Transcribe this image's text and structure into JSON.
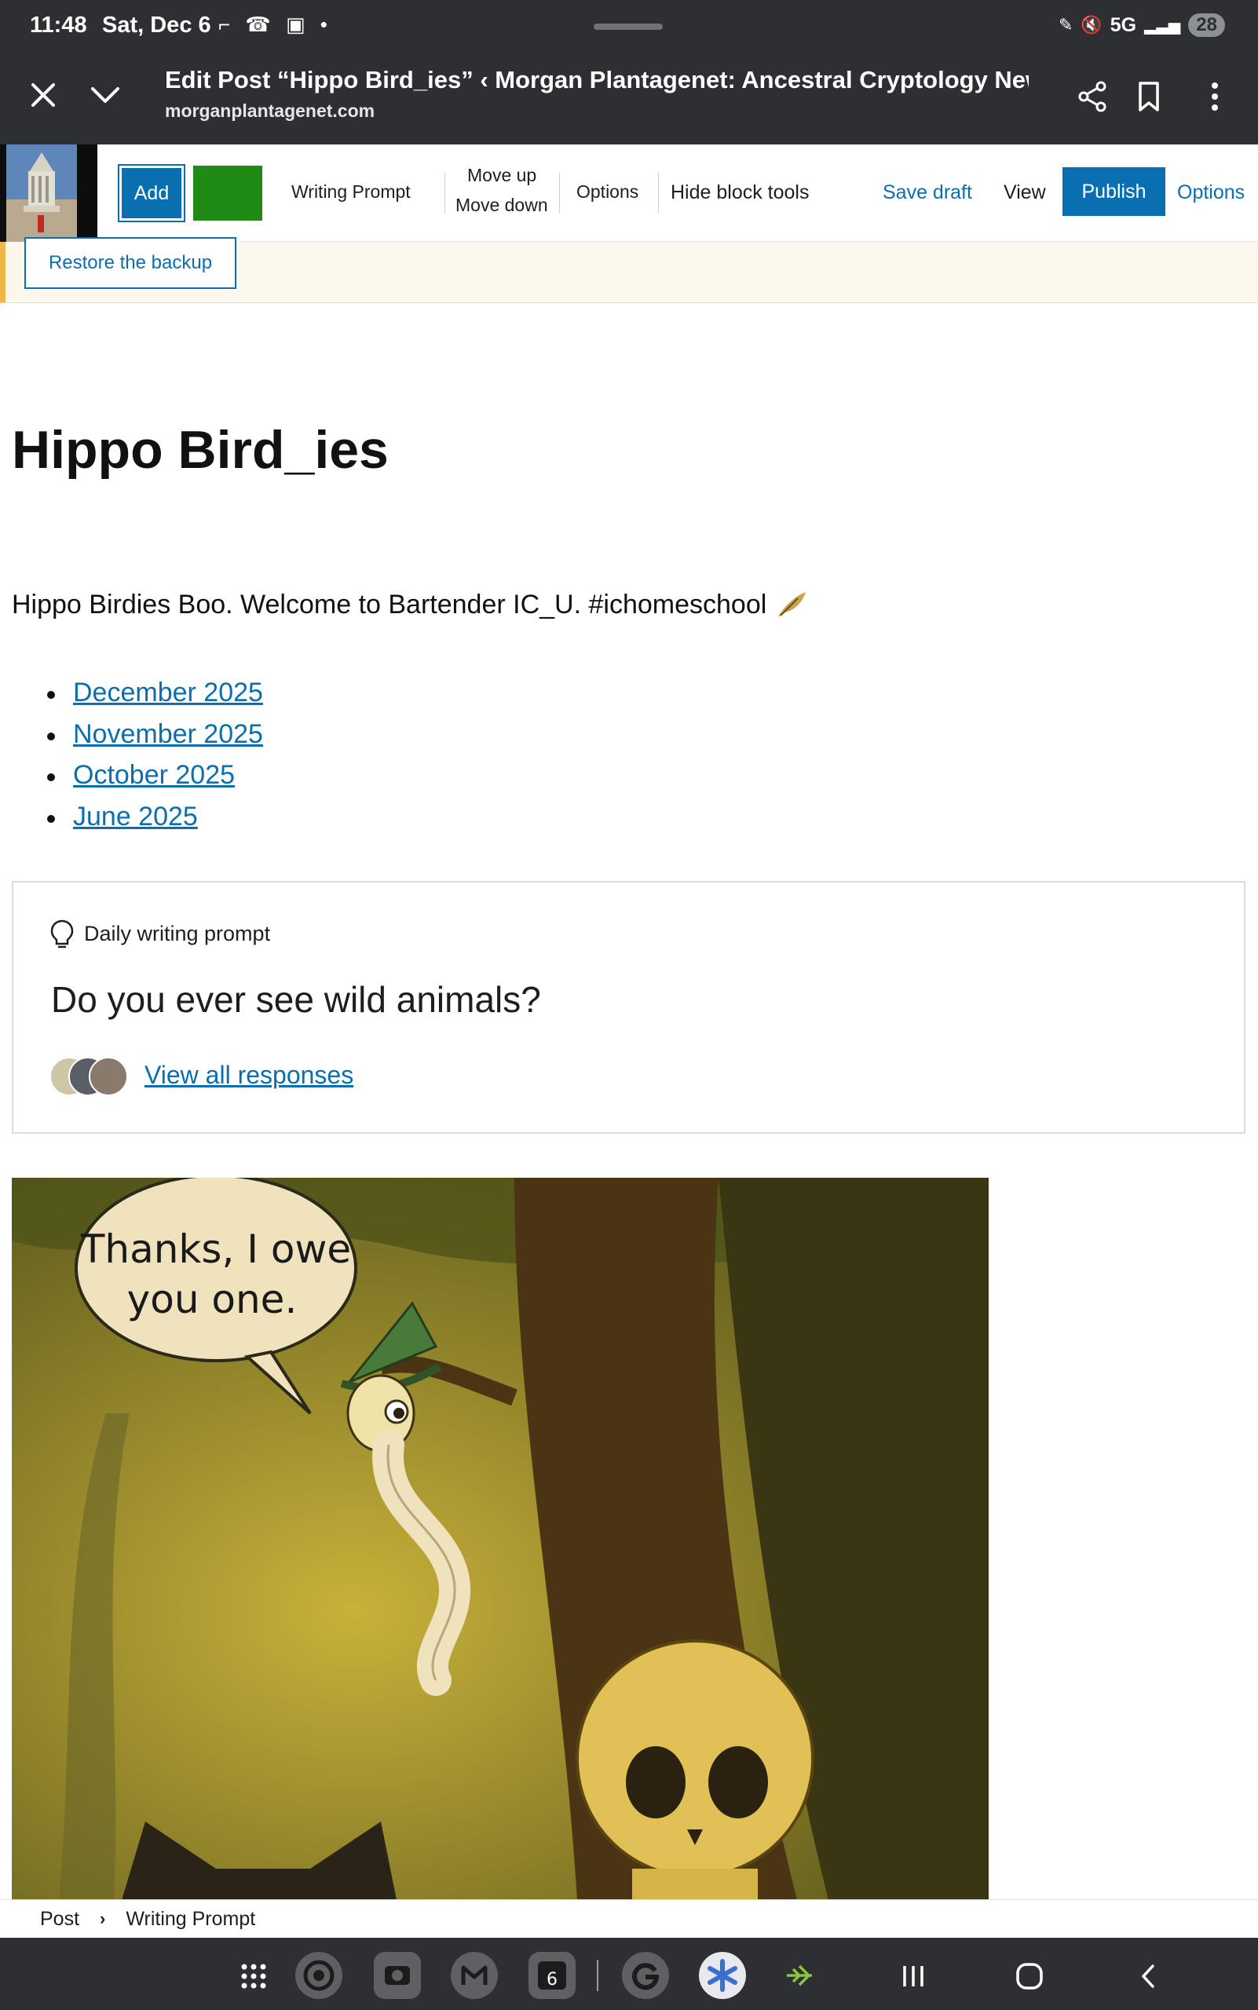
{
  "status_bar": {
    "time": "11:48",
    "date": "Sat, Dec 6",
    "network": "5G",
    "battery": "28"
  },
  "browser": {
    "title": "Edit Post “Hippo Bird_ies” ‹ Morgan Plantagenet: Ancestral Cryptology News — ...",
    "url": "morganplantagenet.com"
  },
  "toolbar": {
    "add_label": "Add",
    "block_name": "Writing Prompt",
    "move_up": "Move up",
    "move_down": "Move down",
    "options_label": "Options",
    "hide_block_tools": "Hide block tools",
    "save_draft": "Save draft",
    "view": "View",
    "publish": "Publish",
    "options_right": "Options",
    "swatch_color": "#1f8a14"
  },
  "notice": {
    "restore_label": "Restore the backup"
  },
  "post": {
    "title": "Hippo Bird_ies",
    "paragraph": "Hippo Birdies Boo. Welcome to Bartender IC_U. #ichomeschool",
    "archives": [
      {
        "label": "December 2025"
      },
      {
        "label": "November 2025"
      },
      {
        "label": "October 2025"
      },
      {
        "label": "June 2025"
      }
    ]
  },
  "writing_prompt": {
    "label": "Daily writing prompt",
    "question": "Do you ever see wild animals?",
    "view_all": "View all responses"
  },
  "comic": {
    "speech_line1": "Thanks, I owe",
    "speech_line2": "you one."
  },
  "breadcrumb": {
    "items": [
      "Post",
      "Writing Prompt"
    ]
  },
  "colors": {
    "accent": "#0a6fb0",
    "notice_border": "#f0b849",
    "system_bar": "#2d2f33"
  }
}
